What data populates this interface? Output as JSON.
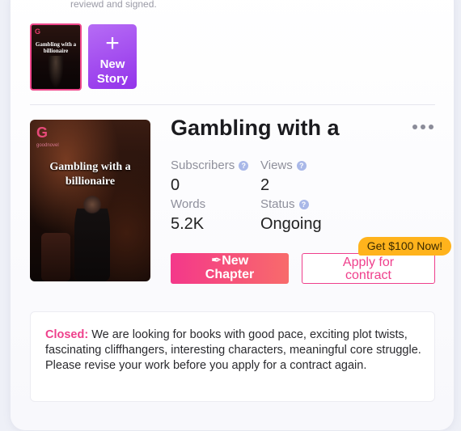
{
  "top_note": "reviewd and signed.",
  "thumbnail": {
    "logo": "G",
    "title": "Gambling with a billionaire"
  },
  "new_story": {
    "plus": "+",
    "label_line1": "New",
    "label_line2": "Story"
  },
  "book": {
    "cover": {
      "logo": "G",
      "logo_sub": "goodnovel",
      "title_line1": "Gambling with a",
      "title_line2": "billionaire"
    },
    "title": "Gambling with a",
    "stats": {
      "subscribers_label": "Subscribers",
      "subscribers_value": "0",
      "views_label": "Views",
      "views_value": "2",
      "words_label": "Words",
      "words_value": "5.2K",
      "status_label": "Status",
      "status_value": "Ongoing"
    },
    "help_glyph": "?"
  },
  "actions": {
    "new_chapter_line1": "New",
    "new_chapter_line2": "Chapter",
    "apply_line1": "Apply for",
    "apply_line2": "contract",
    "promo": "Get $100 Now!"
  },
  "notice": {
    "label": "Closed:",
    "text": " We are looking for books with good pace, exciting plot twists, fascinating cliffhangers, interesting characters, meaningful core struggle. Please revise your work before you apply for a contract again."
  },
  "colors": {
    "accent": "#ef3f8c",
    "purple": "#9333ea",
    "promo": "#ffb31c"
  }
}
